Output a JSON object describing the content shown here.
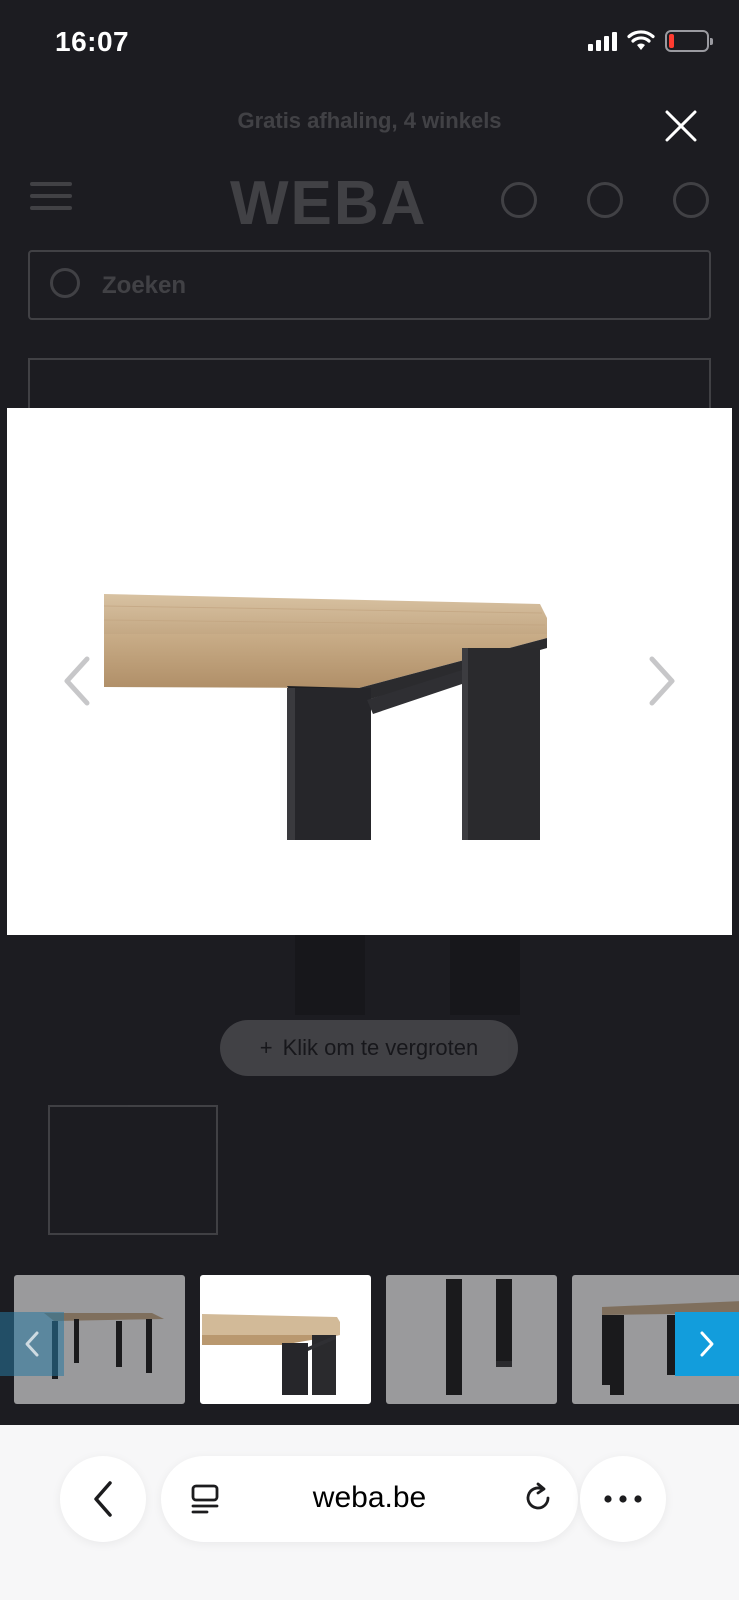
{
  "status_bar": {
    "time": "16:07"
  },
  "background_page": {
    "promo": "Gratis afhaling, 4 winkels",
    "logo": "WEBA",
    "search_placeholder": "Zoeken",
    "zoom_hint": "Klik om te vergroten"
  },
  "lightbox": {
    "close_icon": "close-icon",
    "prev_icon": "chevron-left-icon",
    "next_icon": "chevron-right-icon",
    "image_subject": "table-corner-wood-top-black-legs",
    "thumbnails": [
      {
        "subject": "table-angled-view"
      },
      {
        "subject": "table-corner-closeup",
        "active": true
      },
      {
        "subject": "table-legs-detail"
      },
      {
        "subject": "table-side-view"
      }
    ]
  },
  "browser": {
    "url": "weba.be",
    "back_icon": "chevron-left-icon",
    "tabs_icon": "tab-list-icon",
    "reload_icon": "reload-icon",
    "more_icon": "ellipsis-icon"
  },
  "colors": {
    "overlay_bg": "#1c1c21",
    "accent": "#129ddc",
    "battery_low": "#ff3b30"
  }
}
